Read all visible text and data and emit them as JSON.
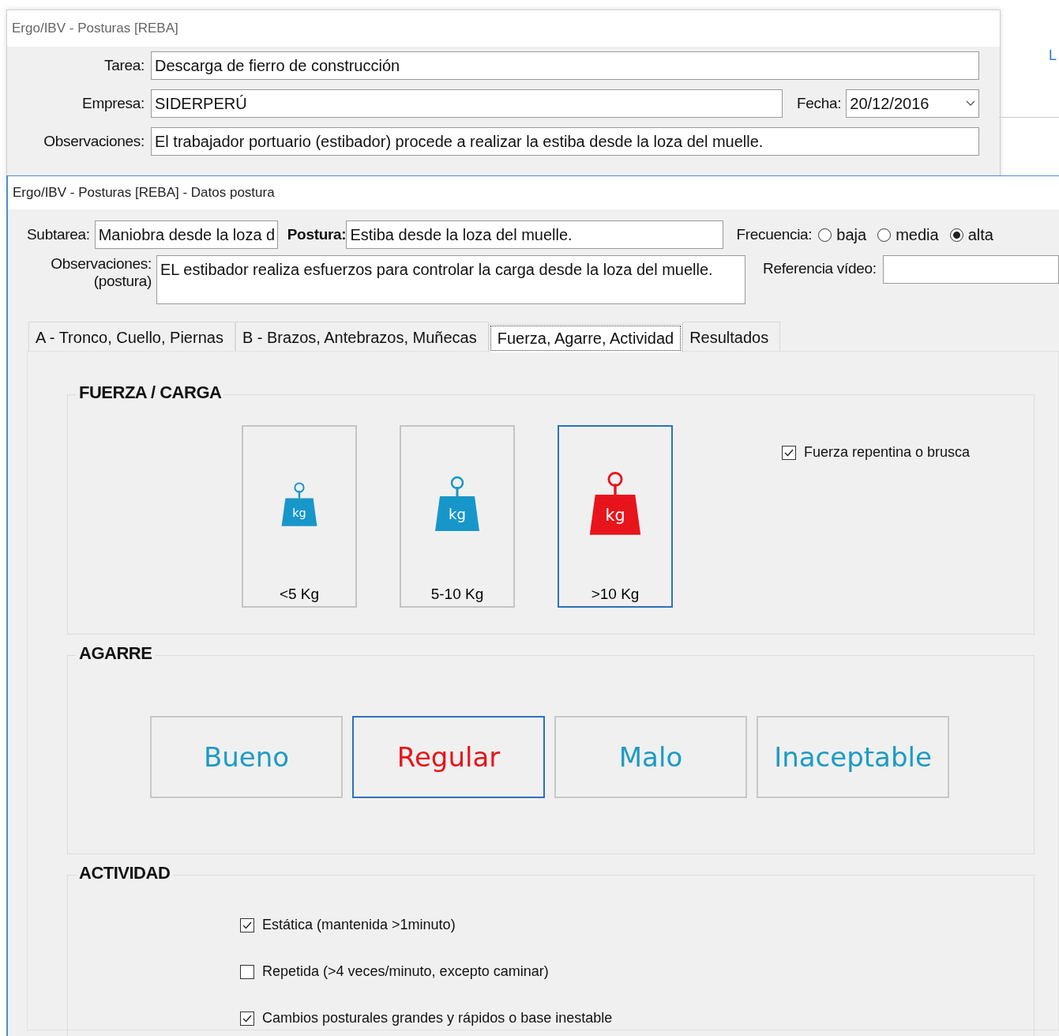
{
  "background_window": {
    "title": "Ergo/IBV - Posturas [REBA]",
    "task": {
      "label": "Tarea:",
      "value": "Descarga de fierro de construcción"
    },
    "company": {
      "label": "Empresa:",
      "value": "SIDERPERÚ"
    },
    "date": {
      "label": "Fecha:",
      "value": "20/12/2016"
    },
    "observations": {
      "label": "Observaciones:",
      "value": "El trabajador portuario (estibador) procede a realizar la estiba desde la loza del muelle."
    },
    "side_link": "L"
  },
  "window": {
    "title": "Ergo/IBV - Posturas [REBA] - Datos postura",
    "subtask": {
      "label": "Subtarea:",
      "value": "Maniobra desde la loza d"
    },
    "posture": {
      "label": "Postura:",
      "value": "Estiba desde la loza del muelle."
    },
    "frequency": {
      "label": "Frecuencia:",
      "options": [
        {
          "label": "baja",
          "selected": false
        },
        {
          "label": "media",
          "selected": false
        },
        {
          "label": "alta",
          "selected": true
        }
      ]
    },
    "observations": {
      "label": "Observaciones:",
      "sublabel": "(postura)",
      "value": "EL estibador realiza esfuerzos para controlar la carga desde la loza del muelle."
    },
    "video_reference": {
      "label": "Referencia vídeo:"
    },
    "tabs": [
      {
        "label": "A - Tronco, Cuello, Piernas",
        "selected": false
      },
      {
        "label": "B - Brazos, Antebrazos, Muñecas",
        "selected": false
      },
      {
        "label": "Fuerza, Agarre, Actividad",
        "selected": true
      },
      {
        "label": "Resultados",
        "selected": false
      }
    ],
    "force": {
      "title": "FUERZA / CARGA",
      "options": [
        {
          "label": "<5 Kg",
          "unit": "kg",
          "kind": "small",
          "selected": false
        },
        {
          "label": "5-10 Kg",
          "unit": "kg",
          "kind": "medium",
          "selected": false
        },
        {
          "label": ">10 Kg",
          "unit": "kg",
          "kind": "large",
          "selected": true
        }
      ],
      "sudden": {
        "label": "Fuerza repentina o brusca",
        "checked": true
      }
    },
    "grip": {
      "title": "AGARRE",
      "options": [
        {
          "label": "Bueno",
          "selected": false
        },
        {
          "label": "Regular",
          "selected": true
        },
        {
          "label": "Malo",
          "selected": false
        },
        {
          "label": "Inaceptable",
          "selected": false
        }
      ]
    },
    "activity": {
      "title": "ACTIVIDAD",
      "items": [
        {
          "label": "Estática (mantenida >1minuto)",
          "checked": true
        },
        {
          "label": "Repetida (>4 veces/minuto, excepto caminar)",
          "checked": false
        },
        {
          "label": "Cambios posturales grandes y rápidos o base inestable",
          "checked": true
        }
      ]
    }
  }
}
